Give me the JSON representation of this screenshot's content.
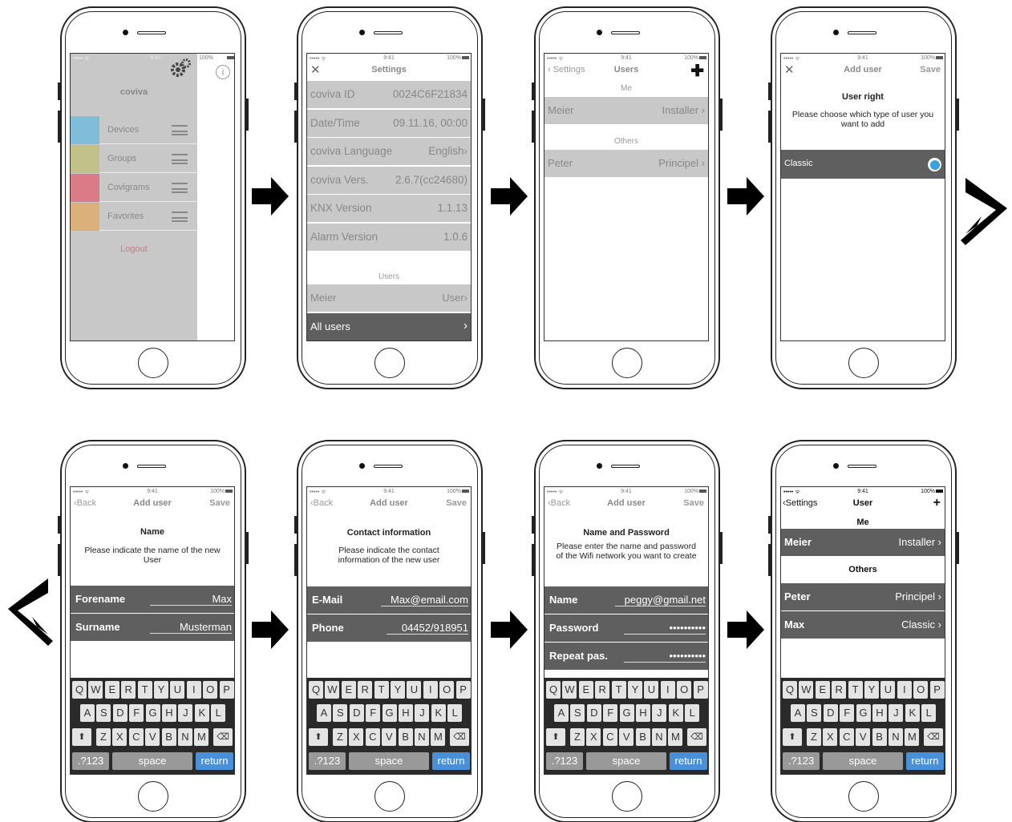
{
  "status": {
    "signal": "••••• ᯤ",
    "time": "9:41",
    "battery": "100%"
  },
  "screens": {
    "s1": {
      "brand": "coviva",
      "menu": [
        "Devices",
        "Groups",
        "Covigrams",
        "Favorites"
      ],
      "menu_colors": [
        "#7fbdd8",
        "#c3c18a",
        "#dc7b88",
        "#dcb07a"
      ],
      "logout": "Logout"
    },
    "s2": {
      "title": "Settings",
      "rows": [
        {
          "k": "coviva ID",
          "v": "0024C6F21834"
        },
        {
          "k": "Date/Time",
          "v": "09.11.16, 00:00"
        },
        {
          "k": "coviva Language",
          "v": "English›"
        },
        {
          "k": "coviva Vers.",
          "v": "2.6.7(cc24680)"
        },
        {
          "k": "KNX Version",
          "v": "1.1.13"
        },
        {
          "k": "Alarm Version",
          "v": "1.0.6"
        }
      ],
      "users_header": "Users",
      "user_row": {
        "k": "Meier",
        "v": "User›"
      },
      "all_users": "All users",
      "chevron": "›"
    },
    "s3": {
      "back": "‹ Settings",
      "title": "Users",
      "me_header": "Me",
      "me_row": {
        "k": "Meier",
        "v": "Installer ›"
      },
      "others_header": "Others",
      "others_row": {
        "k": "Peter",
        "v": "Principel ›"
      }
    },
    "s4": {
      "title": "Add user",
      "save": "Save",
      "heading": "User right",
      "text": "Please choose which type of user you want to add",
      "option": "Classic"
    },
    "s5": {
      "back": "‹Back",
      "title": "Add user",
      "save": "Save",
      "heading": "Name",
      "text": "Please indicate the name of the new User",
      "fields": [
        {
          "k": "Forename",
          "v": "Max"
        },
        {
          "k": "Surname",
          "v": "Musterman"
        }
      ]
    },
    "s6": {
      "back": "‹Back",
      "title": "Add user",
      "save": "Save",
      "heading": "Contact information",
      "text": "Please indicate the contact information of the new user",
      "fields": [
        {
          "k": "E-Mail",
          "v": "Max@email.com"
        },
        {
          "k": "Phone",
          "v": "04452/918951"
        }
      ]
    },
    "s7": {
      "back": "‹Back",
      "title": "Add user",
      "save": "Save",
      "heading": "Name and Password",
      "text": "Please enter the name and password of the Wifi network you want to create",
      "fields": [
        {
          "k": "Name",
          "v": "peggy@gmail.net"
        },
        {
          "k": "Password",
          "v": "••••••••••"
        },
        {
          "k": "Repeat pas.",
          "v": "••••••••••"
        }
      ]
    },
    "s8": {
      "back": "‹Settings",
      "title": "User",
      "plus": "+",
      "me_header": "Me",
      "me_row": {
        "k": "Meier",
        "v": "Installer ›"
      },
      "others_header": "Others",
      "others_rows": [
        {
          "k": "Peter",
          "v": "Principel ›"
        },
        {
          "k": "Max",
          "v": "Classic ›"
        }
      ]
    }
  },
  "keyboard": {
    "row1": [
      "Q",
      "W",
      "E",
      "R",
      "T",
      "Y",
      "U",
      "I",
      "O",
      "P"
    ],
    "row2": [
      "A",
      "S",
      "D",
      "F",
      "G",
      "H",
      "J",
      "K",
      "L"
    ],
    "row3": [
      "Z",
      "X",
      "C",
      "V",
      "B",
      "N",
      "M"
    ],
    "shift": "⬆",
    "delete": "⌫",
    "num": ".?123",
    "space": "space",
    "return": "return"
  }
}
